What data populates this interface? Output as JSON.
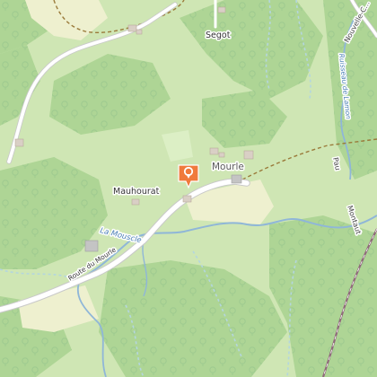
{
  "map": {
    "places": {
      "segot": "Segot",
      "mourle": "Mourle",
      "mauhourat": "Mauhourat"
    },
    "roads": {
      "route_du_mourle": "Route du Mourle",
      "pau": "Pau",
      "montaut": "Montaut",
      "nouvelle": "Nouvelle-C..."
    },
    "waterways": {
      "la_mouscle": "La Mouscle",
      "ruisseau_de_lamon": "Ruisseau de Lamon"
    },
    "marker": {
      "icon": "location-pin-icon",
      "color": "#f07a3c"
    },
    "colors": {
      "meadow": "#cfe6b4",
      "forest": "#aed595",
      "grass": "#dcefc5",
      "farmland": "#eef0cf",
      "water": "#8fb6d8",
      "road": "#ffffff",
      "track": "#9a7a3a",
      "rail": "#8f6a7a",
      "building": "#d9cfc5"
    }
  }
}
